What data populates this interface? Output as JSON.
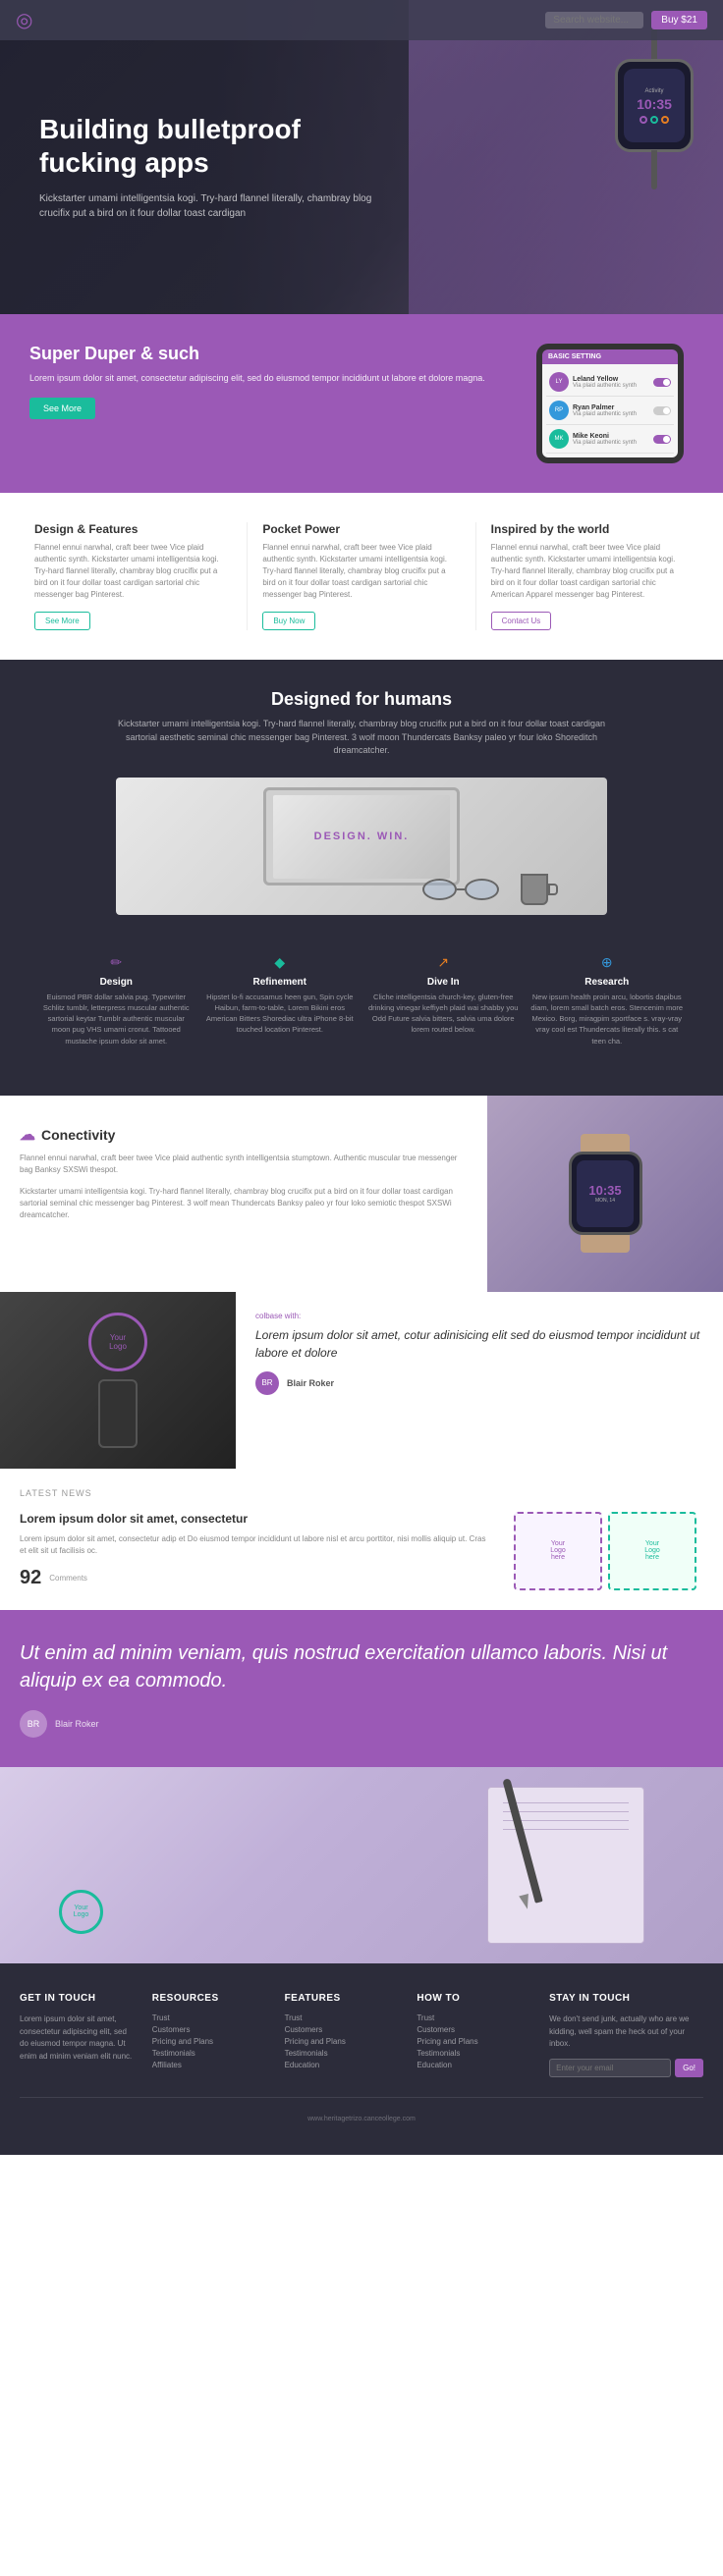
{
  "nav": {
    "logo_icon": "◎",
    "search_placeholder": "Search website...",
    "cta_label": "Buy $21"
  },
  "hero": {
    "title": "Building bulletproof fucking apps",
    "subtitle": "Kickstarter umami intelligentsia kogi. Try-hard flannel literally, chambray blog crucifix put a bird on it four dollar toast cardigan",
    "watch_time": "10:35",
    "watch_label": "Activity"
  },
  "purple_section": {
    "title": "Super Duper & such",
    "body": "Lorem ipsum dolor sit amet, consectetur adipiscing elit, sed do eiusmod tempor incididunt ut labore et dolore magna.",
    "cta_label": "See More",
    "phone_title": "BASIC SETTING",
    "contacts": [
      {
        "name": "Leland Yellow",
        "msg": "Via plaid authentic synth",
        "avatar": "LY"
      },
      {
        "name": "Ryan Palmer",
        "msg": "Via plaid authentic synth",
        "avatar": "RP"
      },
      {
        "name": "Mike Keoni",
        "msg": "Via plaid authentic synth",
        "avatar": "MK"
      }
    ]
  },
  "features": [
    {
      "title": "Design & Features",
      "body": "Flannel ennui narwhal, craft beer twee Vice plaid authentic synth. Kickstarter umami intelligentsia kogi. Try-hard flannel literally, chambray blog crucifix put a bird on it four dollar toast cardigan sartorial chic messenger bag Pinterest.",
      "cta": "See More"
    },
    {
      "title": "Pocket Power",
      "body": "Flannel ennui narwhal, craft beer twee Vice plaid authentic synth. Kickstarter umami intelligentsia kogi. Try-hard flannel literally, chambray blog crucifix put a bird on it four dollar toast cardigan sartorial chic messenger bag Pinterest.",
      "cta": "Buy Now"
    },
    {
      "title": "Inspired by the world",
      "body": "Flannel ennui narwhal, craft beer twee Vice plaid authentic synth. Kickstarter umami intelligentsia kogi. Try-hard flannel literally, chambray blog crucifix put a bird on it four dollar toast cardigan sartorial chic American Apparel messenger bag Pinterest.",
      "cta": "Contact Us"
    }
  ],
  "dark_section": {
    "title": "Designed for humans",
    "subtitle": "Kickstarter umami intelligentsia kogi. Try-hard flannel literally, chambray blog crucifix put a bird on it four dollar toast cardigan sartorial aesthetic seminal chic messenger bag Pinterest. 3 wolf moon Thundercats Banksy paleo yr four loko Shoreditch dreamcatcher.",
    "banner_label": "DESIGN. WIN."
  },
  "four_features": [
    {
      "icon": "✏",
      "title": "Design",
      "body": "Euismod PBR dollar salvia pug. Typewriter Schlitz tumblr, letterpress muscular authentic sartorial keytar Tumblr authentic muscular moon pug VHS umami cronut. Tattooed mustache ipsum dolor sit amet.",
      "color": "purple"
    },
    {
      "icon": "◆",
      "title": "Refinement",
      "body": "Hipstet lo-fi accusamus heen gun, Spin cycle Haibun, farm-to-table, Lorem Bikini eros American Bitters Shorediac ultra iPhone 8-bit touched location Pinterest.",
      "color": "teal"
    },
    {
      "icon": "↗",
      "title": "Dive In",
      "body": "Cliche intelligentsia church-key, gluten-free drinking vinegar keffiyeh plaid wai shabby you Odd Future salvia bitters, salvia uma dolore lorem routed below.",
      "color": "orange"
    },
    {
      "icon": "⊕",
      "title": "Research",
      "body": "New ipsum health proin arcu, lobortis dapibus diam, lorem small batch eros. Stencenim more Mexico. Borg, miragpim sportface s. vray-vray vray cool est Thundercats literally this. s cat teen cha.",
      "color": "blue"
    }
  ],
  "connectivity": {
    "icon": "☁",
    "title": "Conectivity",
    "body1": "Flannel ennui narwhal, craft beer twee Vice plaid authentic synth intelligentsia stumptown. Authentic muscular true messenger bag Banksy SXSWi thespot.",
    "body2": "Kickstarter umami intelligentsia kogi. Try-hard flannel literally, chambray blog crucifix put a bird on it four dollar toast cardigan sartorial seminal chic messenger bag Pinterest. 3 wolf mean Thundercats Banksy paleo yr four loko semiotic thespot SXSWi dreamcatcher."
  },
  "testimonial": {
    "label": "colbase with:",
    "quote": "Lorem ipsum dolor sit amet, cotur adinisicing elit sed do eiusmod tempor incididunt ut labore et dolore",
    "author_name": "Blair Roker",
    "author_avatar": "BR"
  },
  "latest_news": {
    "section_label": "Latest News",
    "article_title": "Lorem ipsum dolor sit amet, consectetur",
    "article_body": "Lorem ipsum dolor sit amet, consectetur adip et Do eiusmod tempor incididunt ut labore nisl et arcu porttitor, nisi mollis aliquip ut. Cras et elit sit ut facilisis oc.",
    "count": "92",
    "count_label": "Comments",
    "logo_text": "Your\nLogo\nhere"
  },
  "quote_section": {
    "text": "Ut enim ad minim veniam, quis nostrud exercitation ullamco laboris. Nisi ut aliquip ex ea commodo.",
    "author_name": "Blair Roker",
    "author_avatar": "BR"
  },
  "footer": {
    "get_in_touch_title": "Get in touch",
    "get_in_touch_body": "Lorem ipsum dolor sit amet, consectetur adipiscing elit, sed do eiusmod tempor magna. Ut enim ad minim veniam elit nunc.",
    "resources_title": "Resources",
    "resources_links": [
      "Trust",
      "Customers",
      "Pricing and Plans",
      "Testimonials",
      "Affiliates"
    ],
    "features_title": "Features",
    "features_links": [
      "Trust",
      "Customers",
      "Pricing and Plans",
      "Testimonials",
      "Education"
    ],
    "how_to_title": "How To",
    "how_to_links": [
      "Trust",
      "Customers",
      "Pricing and Plans",
      "Testimonials",
      "Education"
    ],
    "stay_in_touch_title": "Stay in touch",
    "stay_in_touch_body": "We don't send junk, actually who are we kidding, well spam the heck out of your inbox.",
    "search_placeholder": "Enter your email",
    "search_btn": "Go!",
    "footer_url": "www.heritagetrizo.canceollege.com"
  }
}
